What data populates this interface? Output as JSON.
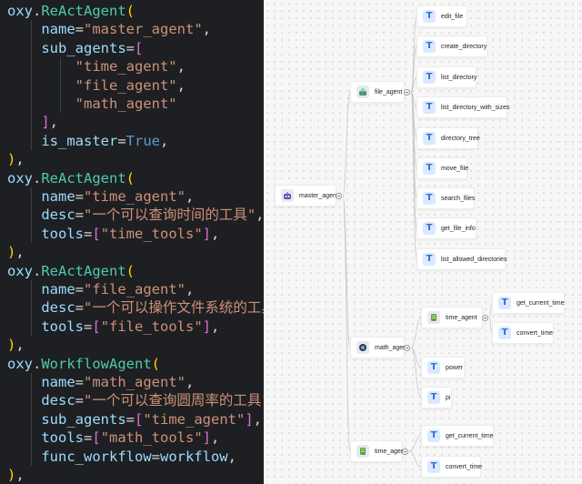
{
  "code": {
    "lines": [
      [
        [
          "oxy",
          "ident"
        ],
        [
          ".",
          "punc"
        ],
        [
          "ReActAgent",
          "call"
        ],
        [
          "(",
          "brk1"
        ]
      ],
      [
        [
          "    name",
          "ident"
        ],
        [
          "=",
          "punc"
        ],
        [
          "\"master_agent\"",
          "str"
        ],
        [
          ",",
          "punc"
        ]
      ],
      [
        [
          "    sub_agents",
          "ident"
        ],
        [
          "=",
          "punc"
        ],
        [
          "[",
          "brk2"
        ]
      ],
      [
        [
          "        \"time_agent\"",
          "str"
        ],
        [
          ",",
          "punc"
        ]
      ],
      [
        [
          "        \"file_agent\"",
          "str"
        ],
        [
          ",",
          "punc"
        ]
      ],
      [
        [
          "        \"math_agent\"",
          "str"
        ]
      ],
      [
        [
          "    ",
          "punc"
        ],
        [
          "]",
          "brk2"
        ],
        [
          ",",
          "punc"
        ]
      ],
      [
        [
          "    is_master",
          "ident"
        ],
        [
          "=",
          "punc"
        ],
        [
          "True",
          "kw"
        ],
        [
          ",",
          "punc"
        ]
      ],
      [
        [
          ")",
          "brk1"
        ],
        [
          ",",
          "punc"
        ]
      ],
      [
        [
          "oxy",
          "ident"
        ],
        [
          ".",
          "punc"
        ],
        [
          "ReActAgent",
          "call"
        ],
        [
          "(",
          "brk1"
        ]
      ],
      [
        [
          "    name",
          "ident"
        ],
        [
          "=",
          "punc"
        ],
        [
          "\"time_agent\"",
          "str"
        ],
        [
          ",",
          "punc"
        ]
      ],
      [
        [
          "    desc",
          "ident"
        ],
        [
          "=",
          "punc"
        ],
        [
          "\"一个可以查询时间的工具\"",
          "str"
        ],
        [
          ",",
          "punc"
        ]
      ],
      [
        [
          "    tools",
          "ident"
        ],
        [
          "=",
          "punc"
        ],
        [
          "[",
          "brk2"
        ],
        [
          "\"time_tools\"",
          "str"
        ],
        [
          "]",
          "brk2"
        ],
        [
          ",",
          "punc"
        ]
      ],
      [
        [
          ")",
          "brk1"
        ],
        [
          ",",
          "punc"
        ]
      ],
      [
        [
          "oxy",
          "ident"
        ],
        [
          ".",
          "punc"
        ],
        [
          "ReActAgent",
          "call"
        ],
        [
          "(",
          "brk1"
        ]
      ],
      [
        [
          "    name",
          "ident"
        ],
        [
          "=",
          "punc"
        ],
        [
          "\"file_agent\"",
          "str"
        ],
        [
          ",",
          "punc"
        ]
      ],
      [
        [
          "    desc",
          "ident"
        ],
        [
          "=",
          "punc"
        ],
        [
          "\"一个可以操作文件系统的工具\"",
          "str"
        ],
        [
          ",",
          "punc"
        ]
      ],
      [
        [
          "    tools",
          "ident"
        ],
        [
          "=",
          "punc"
        ],
        [
          "[",
          "brk2"
        ],
        [
          "\"file_tools\"",
          "str"
        ],
        [
          "]",
          "brk2"
        ],
        [
          ",",
          "punc"
        ]
      ],
      [
        [
          ")",
          "brk1"
        ],
        [
          ",",
          "punc"
        ]
      ],
      [
        [
          "oxy",
          "ident"
        ],
        [
          ".",
          "punc"
        ],
        [
          "WorkflowAgent",
          "call"
        ],
        [
          "(",
          "brk1"
        ]
      ],
      [
        [
          "    name",
          "ident"
        ],
        [
          "=",
          "punc"
        ],
        [
          "\"math_agent\"",
          "str"
        ],
        [
          ",",
          "punc"
        ]
      ],
      [
        [
          "    desc",
          "ident"
        ],
        [
          "=",
          "punc"
        ],
        [
          "\"一个可以查询圆周率的工具\"",
          "str"
        ],
        [
          ",",
          "punc"
        ]
      ],
      [
        [
          "    sub_agents",
          "ident"
        ],
        [
          "=",
          "punc"
        ],
        [
          "[",
          "brk2"
        ],
        [
          "\"time_agent\"",
          "str"
        ],
        [
          "]",
          "brk2"
        ],
        [
          ",",
          "punc"
        ]
      ],
      [
        [
          "    tools",
          "ident"
        ],
        [
          "=",
          "punc"
        ],
        [
          "[",
          "brk2"
        ],
        [
          "\"math_tools\"",
          "str"
        ],
        [
          "]",
          "brk2"
        ],
        [
          ",",
          "punc"
        ]
      ],
      [
        [
          "    func_workflow",
          "ident"
        ],
        [
          "=",
          "punc"
        ],
        [
          "workflow",
          "ident"
        ],
        [
          ",",
          "punc"
        ]
      ],
      [
        [
          ")",
          "brk1"
        ],
        [
          ",",
          "punc"
        ]
      ]
    ]
  },
  "graph": {
    "nodes": [
      {
        "id": "master_agent",
        "label": "master_agent",
        "kind": "agent",
        "icon": "robot-icon",
        "collapsible": true
      },
      {
        "id": "file_agent",
        "label": "file_agent",
        "kind": "agent",
        "icon": "file-agent-icon",
        "collapsible": true
      },
      {
        "id": "math_agent",
        "label": "math_agent",
        "kind": "agent",
        "icon": "math-agent-icon",
        "collapsible": true
      },
      {
        "id": "time_agent",
        "label": "time_agent",
        "kind": "agent",
        "icon": "time-agent-icon",
        "collapsible": true
      },
      {
        "id": "edit_file",
        "label": "edit_file",
        "kind": "tool",
        "icon": "tool-icon"
      },
      {
        "id": "create_directory",
        "label": "create_directory",
        "kind": "tool",
        "icon": "tool-icon"
      },
      {
        "id": "list_directory",
        "label": "list_directory",
        "kind": "tool",
        "icon": "tool-icon"
      },
      {
        "id": "list_directory_with_sizes",
        "label": "list_directory_with_sizes",
        "kind": "tool",
        "icon": "tool-icon"
      },
      {
        "id": "directory_tree",
        "label": "directory_tree",
        "kind": "tool",
        "icon": "tool-icon"
      },
      {
        "id": "move_file",
        "label": "move_file",
        "kind": "tool",
        "icon": "tool-icon"
      },
      {
        "id": "search_files",
        "label": "search_files",
        "kind": "tool",
        "icon": "tool-icon"
      },
      {
        "id": "get_file_info",
        "label": "get_file_info",
        "kind": "tool",
        "icon": "tool-icon"
      },
      {
        "id": "list_allowed_directories",
        "label": "list_allowed_directories",
        "kind": "tool",
        "icon": "tool-icon"
      },
      {
        "id": "math_time_agent",
        "label": "time_agent",
        "kind": "agent",
        "icon": "time-agent-icon",
        "collapsible": true
      },
      {
        "id": "math_time_get_current_time",
        "label": "get_current_time",
        "kind": "tool",
        "icon": "tool-icon"
      },
      {
        "id": "math_time_convert_time",
        "label": "convert_time",
        "kind": "tool",
        "icon": "tool-icon"
      },
      {
        "id": "power",
        "label": "power",
        "kind": "tool",
        "icon": "tool-icon"
      },
      {
        "id": "pi",
        "label": "pi",
        "kind": "tool",
        "icon": "tool-icon"
      },
      {
        "id": "time_get_current_time",
        "label": "get_current_time",
        "kind": "tool",
        "icon": "tool-icon"
      },
      {
        "id": "time_convert_time",
        "label": "convert_time",
        "kind": "tool",
        "icon": "tool-icon"
      }
    ],
    "edges": [
      [
        "master_agent",
        "file_agent"
      ],
      [
        "master_agent",
        "math_agent"
      ],
      [
        "master_agent",
        "time_agent"
      ],
      [
        "file_agent",
        "edit_file"
      ],
      [
        "file_agent",
        "create_directory"
      ],
      [
        "file_agent",
        "list_directory"
      ],
      [
        "file_agent",
        "list_directory_with_sizes"
      ],
      [
        "file_agent",
        "directory_tree"
      ],
      [
        "file_agent",
        "move_file"
      ],
      [
        "file_agent",
        "search_files"
      ],
      [
        "file_agent",
        "get_file_info"
      ],
      [
        "file_agent",
        "list_allowed_directories"
      ],
      [
        "math_agent",
        "math_time_agent"
      ],
      [
        "math_agent",
        "power"
      ],
      [
        "math_agent",
        "pi"
      ],
      [
        "math_time_agent",
        "math_time_get_current_time"
      ],
      [
        "math_time_agent",
        "math_time_convert_time"
      ],
      [
        "time_agent",
        "time_get_current_time"
      ],
      [
        "time_agent",
        "time_convert_time"
      ]
    ]
  }
}
